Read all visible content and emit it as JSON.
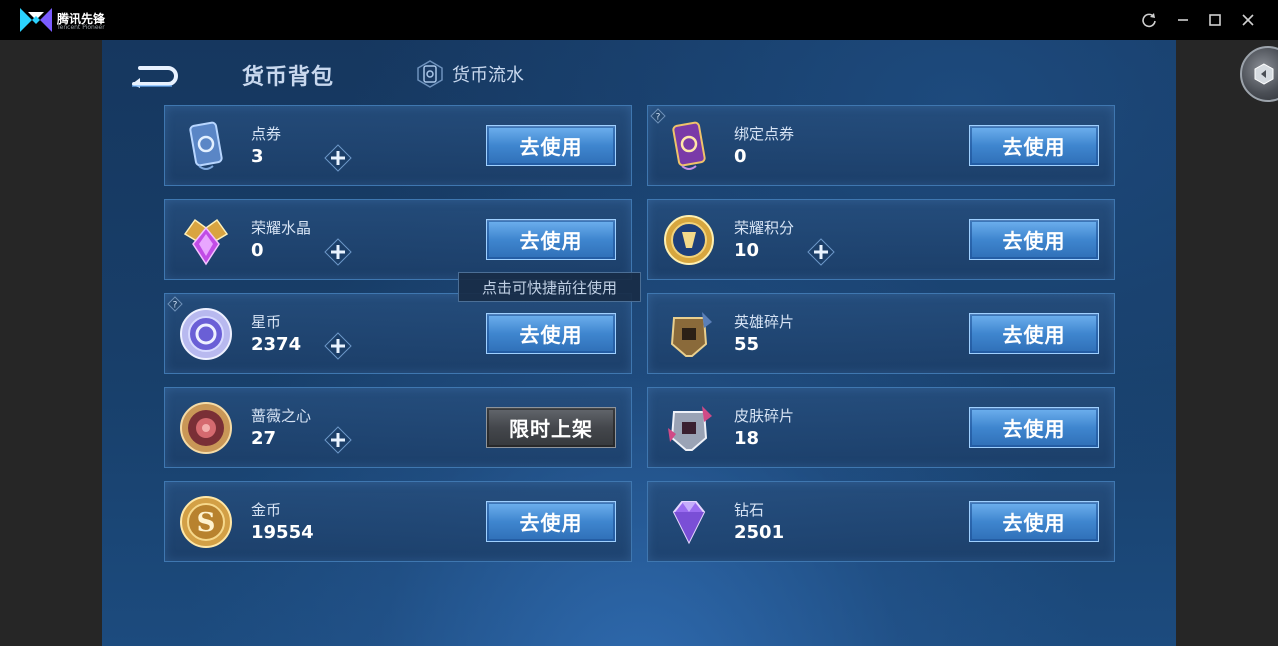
{
  "window": {
    "app_name": "腾讯先锋",
    "app_sub": "Tencent Pioneer"
  },
  "header": {
    "title": "货币背包",
    "flow_tab": "货币流水"
  },
  "tooltip": "点击可快捷前往使用",
  "cards": [
    {
      "name": "点券",
      "value": "3",
      "button": "去使用",
      "icon": "coupon-card-icon"
    },
    {
      "name": "绑定点券",
      "value": "0",
      "button": "去使用",
      "icon": "bound-coupon-card-icon"
    },
    {
      "name": "荣耀水晶",
      "value": "0",
      "button": "去使用",
      "icon": "glory-crystal-icon"
    },
    {
      "name": "荣耀积分",
      "value": "10",
      "button": "去使用",
      "icon": "glory-points-icon"
    },
    {
      "name": "星币",
      "value": "2374",
      "button": "去使用",
      "icon": "star-coin-icon"
    },
    {
      "name": "英雄碎片",
      "value": "55",
      "button": "去使用",
      "icon": "hero-fragment-icon"
    },
    {
      "name": "蔷薇之心",
      "value": "27",
      "button": "限时上架",
      "icon": "rose-heart-icon"
    },
    {
      "name": "皮肤碎片",
      "value": "18",
      "button": "去使用",
      "icon": "skin-fragment-icon"
    },
    {
      "name": "金币",
      "value": "19554",
      "button": "去使用",
      "icon": "gold-coin-icon"
    },
    {
      "name": "钻石",
      "value": "2501",
      "button": "去使用",
      "icon": "diamond-icon"
    }
  ],
  "colors": {
    "button_blue": "#3f86cf",
    "button_gray": "#44474c",
    "card_border": "#3f77b0"
  }
}
